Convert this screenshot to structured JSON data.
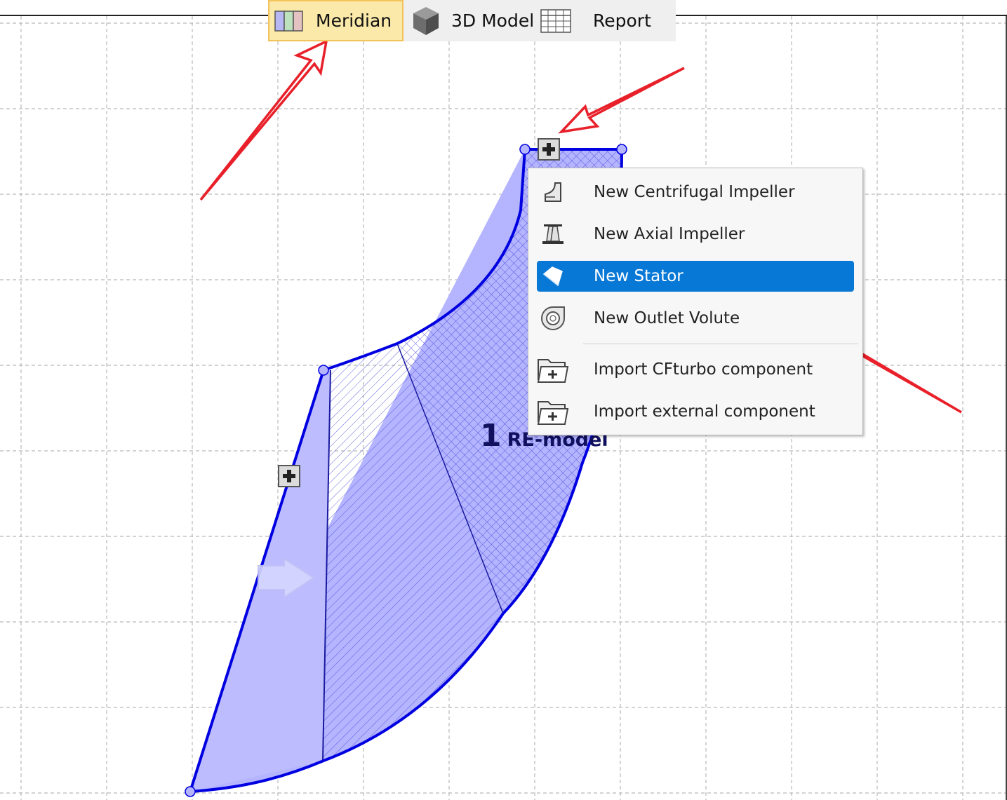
{
  "tabs": [
    {
      "label": "Meridian",
      "icon": "meridian-icon",
      "active": true
    },
    {
      "label": "3D Model",
      "icon": "cube-icon",
      "active": false
    },
    {
      "label": "Report",
      "icon": "table-icon",
      "active": false
    }
  ],
  "component": {
    "number": "1",
    "name": "RE-model"
  },
  "context_menu": {
    "items": [
      {
        "label": "New Centrifugal Impeller",
        "icon": "centrifugal-impeller-icon"
      },
      {
        "label": "New Axial Impeller",
        "icon": "axial-impeller-icon"
      },
      {
        "label": "New Stator",
        "icon": "stator-icon",
        "selected": true
      },
      {
        "label": "New Outlet Volute",
        "icon": "volute-icon"
      },
      {
        "label": "Import CFturbo component",
        "icon": "folder-import-icon"
      },
      {
        "label": "Import external component",
        "icon": "folder-import-icon"
      }
    ]
  },
  "colors": {
    "accent": "#0878d7",
    "component_fill": "#b4b4ff",
    "component_outline": "#0000e0",
    "annotation_arrow": "#e8202a",
    "active_tab": "#fbe9a9"
  }
}
